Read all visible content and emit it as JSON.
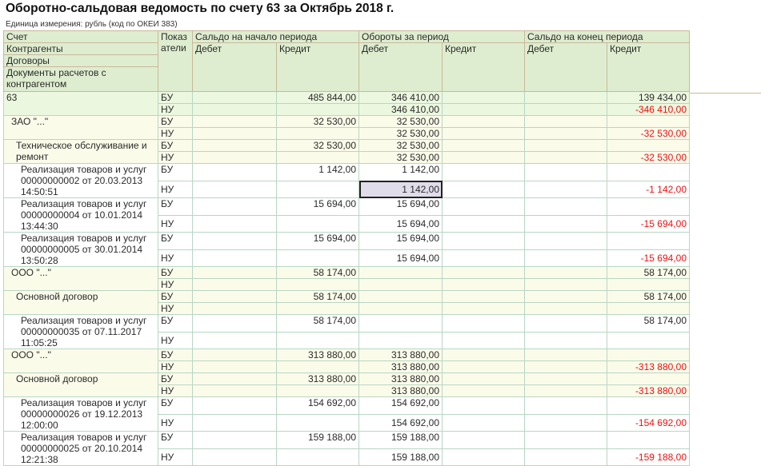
{
  "title": "Оборотно-сальдовая ведомость по счету 63 за Октябрь 2018 г.",
  "unit_label": "Единица измерения:   рубль (код по ОКЕИ 383)",
  "header": {
    "col1": [
      "Счет",
      "Контрагенты",
      "Договоры",
      "Документы расчетов с контрагентом"
    ],
    "indicators": "Показ атели",
    "opening": "Сальдо на начало периода",
    "turnover": "Обороты за период",
    "closing": "Сальдо на конец периода",
    "debit": "Дебет",
    "credit": "Кредит"
  },
  "selected": {
    "row": 3,
    "sub": "nu",
    "col": 2
  },
  "rows": [
    {
      "level": 0,
      "label": "63",
      "bu": [
        "",
        "485 844,00",
        "346 410,00",
        "",
        "",
        "139 434,00"
      ],
      "nu": [
        "",
        "",
        "346 410,00",
        "",
        "",
        "-346 410,00"
      ]
    },
    {
      "level": 1,
      "label": "ЗАО \"...\"",
      "bu": [
        "",
        "32 530,00",
        "32 530,00",
        "",
        "",
        ""
      ],
      "nu": [
        "",
        "",
        "32 530,00",
        "",
        "",
        "-32 530,00"
      ]
    },
    {
      "level": 2,
      "label": "Техническое обслуживание и ремонт",
      "bu": [
        "",
        "32 530,00",
        "32 530,00",
        "",
        "",
        ""
      ],
      "nu": [
        "",
        "",
        "32 530,00",
        "",
        "",
        "-32 530,00"
      ]
    },
    {
      "level": 3,
      "label": "Реализация товаров и услуг 00000000002 от 20.03.2013 14:50:51",
      "bu": [
        "",
        "1 142,00",
        "1 142,00",
        "",
        "",
        ""
      ],
      "nu": [
        "",
        "",
        "1 142,00",
        "",
        "",
        "-1 142,00"
      ]
    },
    {
      "level": 3,
      "label": "Реализация товаров и услуг 00000000004 от 10.01.2014 13:44:30",
      "bu": [
        "",
        "15 694,00",
        "15 694,00",
        "",
        "",
        ""
      ],
      "nu": [
        "",
        "",
        "15 694,00",
        "",
        "",
        "-15 694,00"
      ]
    },
    {
      "level": 3,
      "label": "Реализация товаров и услуг 00000000005 от 30.01.2014 13:50:28",
      "bu": [
        "",
        "15 694,00",
        "15 694,00",
        "",
        "",
        ""
      ],
      "nu": [
        "",
        "",
        "15 694,00",
        "",
        "",
        "-15 694,00"
      ]
    },
    {
      "level": 1,
      "label": "ООО \"...\"",
      "bu": [
        "",
        "58 174,00",
        "",
        "",
        "",
        "58 174,00"
      ],
      "nu": [
        "",
        "",
        "",
        "",
        "",
        ""
      ]
    },
    {
      "level": 2,
      "label": "Основной договор",
      "bu": [
        "",
        "58 174,00",
        "",
        "",
        "",
        "58 174,00"
      ],
      "nu": [
        "",
        "",
        "",
        "",
        "",
        ""
      ]
    },
    {
      "level": 3,
      "label": "Реализация товаров и услуг 00000000035 от 07.11.2017 11:05:25",
      "bu": [
        "",
        "58 174,00",
        "",
        "",
        "",
        "58 174,00"
      ],
      "nu": [
        "",
        "",
        "",
        "",
        "",
        ""
      ]
    },
    {
      "level": 1,
      "label": "ООО \"...\"",
      "bu": [
        "",
        "313 880,00",
        "313 880,00",
        "",
        "",
        ""
      ],
      "nu": [
        "",
        "",
        "313 880,00",
        "",
        "",
        "-313 880,00"
      ]
    },
    {
      "level": 2,
      "label": "Основной договор",
      "bu": [
        "",
        "313 880,00",
        "313 880,00",
        "",
        "",
        ""
      ],
      "nu": [
        "",
        "",
        "313 880,00",
        "",
        "",
        "-313 880,00"
      ]
    },
    {
      "level": 3,
      "label": "Реализация товаров и услуг 00000000026 от 19.12.2013 12:00:00",
      "bu": [
        "",
        "154 692,00",
        "154 692,00",
        "",
        "",
        ""
      ],
      "nu": [
        "",
        "",
        "154 692,00",
        "",
        "",
        "-154 692,00"
      ]
    },
    {
      "level": 3,
      "label": "Реализация товаров и услуг 00000000025 от 20.10.2014 12:21:38",
      "bu": [
        "",
        "159 188,00",
        "159 188,00",
        "",
        "",
        ""
      ],
      "nu": [
        "",
        "",
        "159 188,00",
        "",
        "",
        "-159 188,00"
      ]
    }
  ],
  "indicator_labels": {
    "bu": "БУ",
    "nu": "НУ"
  }
}
